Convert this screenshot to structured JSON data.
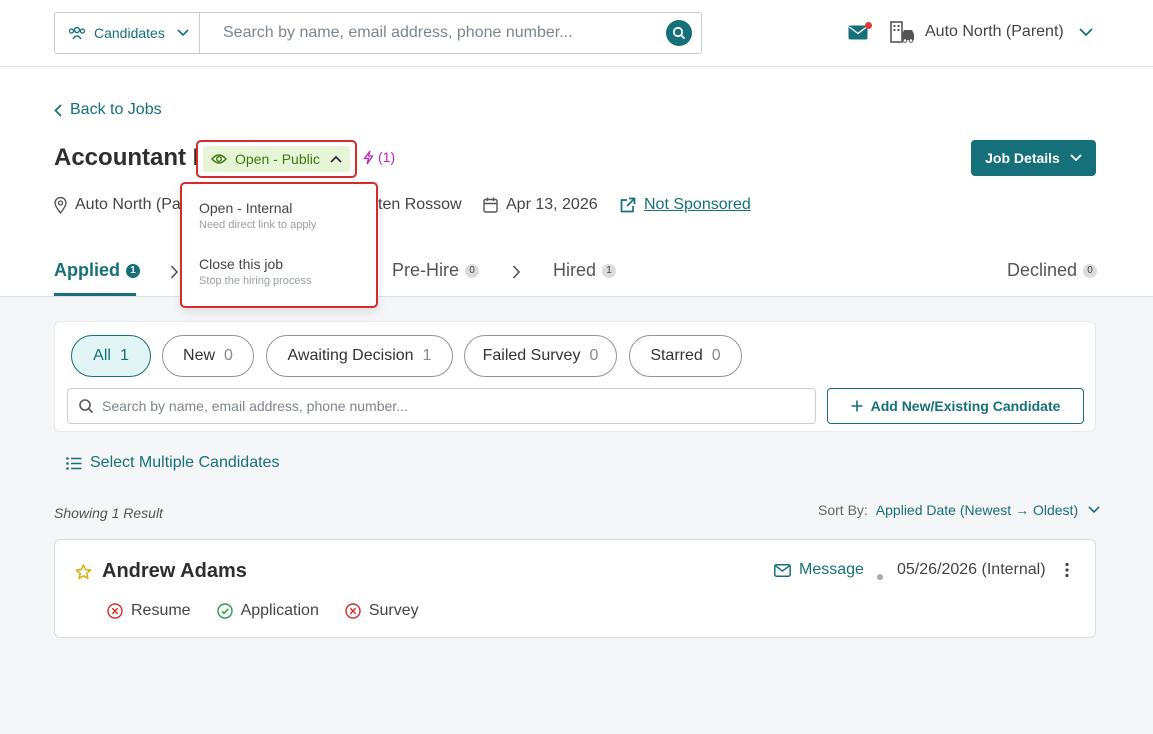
{
  "topbar": {
    "candidates_select": "Candidates",
    "search_placeholder": "Search by name, email address, phone number...",
    "org_name": "Auto North (Parent)"
  },
  "back_link": "Back to Jobs",
  "job": {
    "title": "Accountant I",
    "status": "Open - Public",
    "automation_count": "(1)",
    "job_details_button": "Job Details",
    "location": "Auto North (Pa",
    "recruiter": "sten Rossow",
    "date": "Apr 13, 2026",
    "sponsor": "Not Sponsored"
  },
  "status_dropdown": {
    "items": [
      {
        "title": "Open - Internal",
        "subtitle": "Need direct link to apply"
      },
      {
        "title": "Close this job",
        "subtitle": "Stop the hiring process"
      }
    ]
  },
  "stages": [
    {
      "label": "Applied",
      "count": "1"
    },
    {
      "label": "Pre-Hire",
      "count": "0"
    },
    {
      "label": "Hired",
      "count": "1"
    },
    {
      "label": "Declined",
      "count": "0"
    }
  ],
  "filters": [
    {
      "label": "All",
      "count": "1"
    },
    {
      "label": "New",
      "count": "0"
    },
    {
      "label": "Awaiting Decision",
      "count": "1"
    },
    {
      "label": "Failed Survey",
      "count": "0"
    },
    {
      "label": "Starred",
      "count": "0"
    }
  ],
  "candidate_search_placeholder": "Search by name, email address, phone number...",
  "add_candidate_button": "Add New/Existing Candidate",
  "select_multiple": "Select Multiple Candidates",
  "showing": "Showing 1 Result",
  "sort": {
    "label": "Sort By:",
    "value": "Applied Date (Newest → Oldest)"
  },
  "candidate": {
    "name": "Andrew Adams",
    "message": "Message",
    "date": "05/26/2026 (Internal)",
    "docs": [
      {
        "label": "Resume",
        "status": "missing"
      },
      {
        "label": "Application",
        "status": "complete"
      },
      {
        "label": "Survey",
        "status": "missing"
      }
    ]
  },
  "colors": {
    "accent": "#15707a",
    "status_bg": "#e6f5d6",
    "highlight": "#d42b2b",
    "automation": "#c026b8"
  }
}
